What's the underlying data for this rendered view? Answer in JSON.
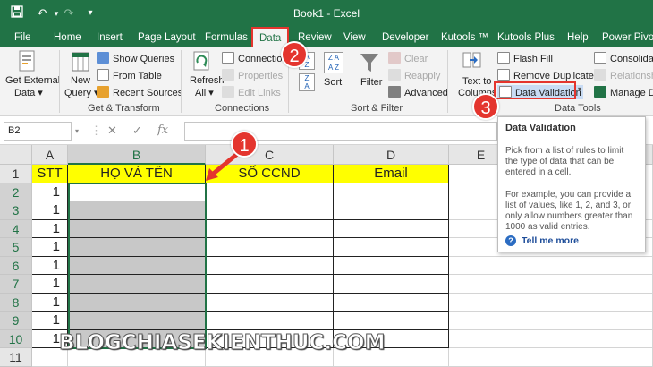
{
  "title_bar": {
    "title": "Book1  -  Excel"
  },
  "tabs": [
    {
      "label": "File"
    },
    {
      "label": "Home"
    },
    {
      "label": "Insert"
    },
    {
      "label": "Page Layout"
    },
    {
      "label": "Formulas"
    },
    {
      "label": "Data"
    },
    {
      "label": "Review"
    },
    {
      "label": "View"
    },
    {
      "label": "Developer"
    },
    {
      "label": "Kutools ™"
    },
    {
      "label": "Kutools Plus"
    },
    {
      "label": "Help"
    },
    {
      "label": "Power Pivot"
    }
  ],
  "ribbon": {
    "get_external_data": [
      "Get External",
      "Data ▾"
    ],
    "new_query": [
      "New",
      "Query ▾"
    ],
    "show_queries": "Show Queries",
    "from_table": "From Table",
    "recent_sources": "Recent Sources",
    "refresh_all": [
      "Refresh",
      "All ▾"
    ],
    "connections": "Connections",
    "properties": "Properties",
    "edit_links": "Edit Links",
    "sort_az": "A\nZ",
    "sort": "Sort",
    "filter": "Filter",
    "clear": "Clear",
    "reapply": "Reapply",
    "advanced": "Advanced",
    "text_to_columns": [
      "Text to",
      "Columns"
    ],
    "flash_fill": "Flash Fill",
    "remove_duplicates": "Remove Duplicates",
    "data_validation": "Data Validation",
    "consolidate": "Consolidate",
    "relationships": "Relationships",
    "manage_data_model": "Manage Data Model",
    "groups": {
      "get_transform": "Get & Transform",
      "connections": "Connections",
      "sort_filter": "Sort & Filter",
      "data_tools": "Data Tools"
    }
  },
  "formula_bar": {
    "name_box": "B2",
    "fx": "fx"
  },
  "columns": [
    "A",
    "B",
    "C",
    "D",
    "E"
  ],
  "rows": [
    "1",
    "2",
    "3",
    "4",
    "5",
    "6",
    "7",
    "8",
    "9",
    "10",
    "11"
  ],
  "header_row": {
    "a": "STT",
    "b": "HỌ VÀ TÊN",
    "c": "SỐ CCND",
    "d": "Email"
  },
  "stt_values": [
    "1",
    "1",
    "1",
    "1",
    "1",
    "1",
    "1",
    "1",
    "1"
  ],
  "tooltip": {
    "title": "Data Validation",
    "body1": "Pick from a list of rules to limit the type of data that can be entered in a cell.",
    "body2": "For example, you can provide a list of values, like 1, 2, and 3, or only allow numbers greater than 1000 as valid entries.",
    "link": "Tell me more"
  },
  "markers": [
    "1",
    "2",
    "3"
  ],
  "watermark": "BLOGCHIASEKIENTHUC.COM",
  "colors": {
    "excel_green": "#217346",
    "highlight_red": "#e4352e",
    "header_yellow": "#ffff00",
    "selection_gray": "#c8c8c8"
  }
}
